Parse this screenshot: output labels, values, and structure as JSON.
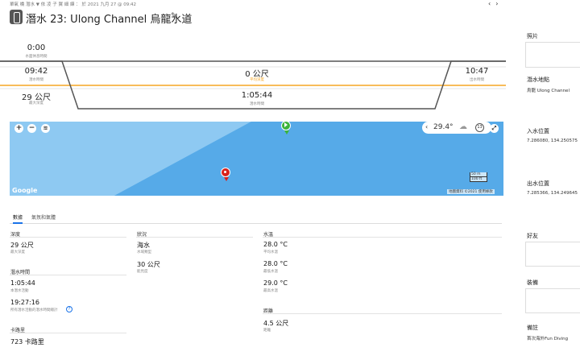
{
  "header": {
    "meta": "單氧 橋 潛水 ▼ 依 凌 子 翼  細 練 ： 於 2021 九月 27 @ 09:42",
    "title": "潛水 23: Ulong Channel 烏龍水道",
    "nav_prev": "‹",
    "nav_next": "›"
  },
  "profile": {
    "surface_value": "0:00",
    "surface_label": "水面休息時間",
    "entry_time": "09:42",
    "entry_label": "潛水時間",
    "max_depth": "29 公尺",
    "max_depth_label": "最大深度",
    "avg_depth": "0 公尺",
    "avg_depth_label": "平均深度",
    "dive_time": "1:05:44",
    "dive_time_label": "潛水時間",
    "exit_time": "10:47",
    "exit_label": "出水時間"
  },
  "map": {
    "temperature": "29.4°",
    "uv": "13",
    "google": "Google",
    "scale_m": "50 m",
    "scale_ft": "100 ft",
    "footer": "地圖資料 ©2021   使用條款"
  },
  "tabs": {
    "data": "數據",
    "weather": "氣氛和氣體"
  },
  "stats": {
    "depth": {
      "heading": "深度",
      "max_value": "29 公尺",
      "max_label": "最大深度"
    },
    "dive_time": {
      "heading": "潛水時間",
      "total_value": "1:05:44",
      "total_label": "本潛水活動",
      "all_value": "19:27:16",
      "all_label": "所有潛水活動的潛水時間總計"
    },
    "calories": {
      "heading": "卡路里",
      "value": "723 卡路里"
    },
    "conditions": {
      "heading": "狀況",
      "type_value": "海水",
      "type_label": "水域類型",
      "vis_value": "30 公尺",
      "vis_label": "能見度"
    },
    "water_temp": {
      "heading": "水溫",
      "avg_value": "28.0 °C",
      "avg_label": "平均水溫",
      "min_value": "28.0 °C",
      "min_label": "最低水溫",
      "max_value": "29.0 °C",
      "max_label": "最高水溫"
    },
    "distance": {
      "heading": "距離",
      "value": "4.5 公尺",
      "label": "距離"
    }
  },
  "sidebar": {
    "photos": "照片",
    "site_label": "潛水地點",
    "site_value": "烏龍 Ulong Channel",
    "entry_label": "入水位置",
    "entry_value": "7.286080, 134.250575",
    "exit_label": "出水位置",
    "exit_value": "7.285366, 134.249645",
    "buddy_label": "好友",
    "gear_label": "裝備",
    "notes_label": "備註",
    "notes_value": "首次海外Fun Diving"
  },
  "colors": {
    "accent": "#1a73e8",
    "avg_line": "#f5a623",
    "map_water": "#5ab0ec",
    "start_pin": "#3bb33b",
    "end_pin": "#d9221c"
  }
}
